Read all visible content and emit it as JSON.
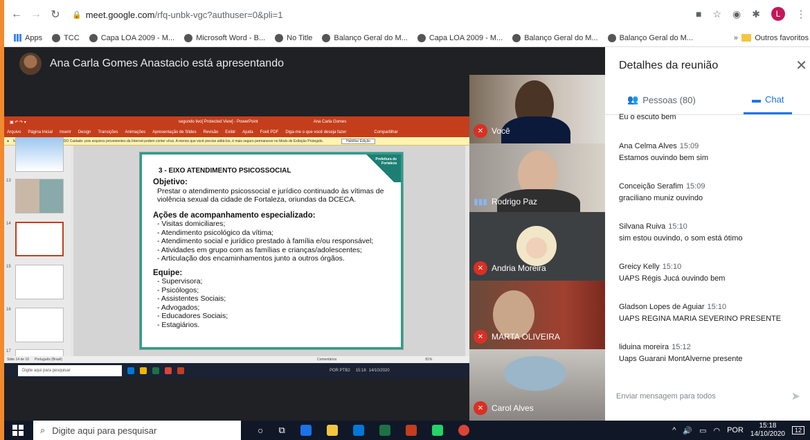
{
  "browser": {
    "url_host": "meet.google.com",
    "url_path": "/rfq-unbk-vgc?authuser=0&pli=1",
    "profile_initial": "L",
    "bookmarks": [
      "Apps",
      "TCC",
      "Capa LOA 2009 - M...",
      "Microsoft Word - B...",
      "No Title",
      "Balanço Geral do M...",
      "Capa LOA 2009 - M...",
      "Balanço Geral do M...",
      "Balanço Geral do M..."
    ],
    "bookmarks_more": "»",
    "other_favorites": "Outros favoritos"
  },
  "presentation": {
    "presenter_text": "Ana Carla Gomes Anastacio está apresentando",
    "ppt": {
      "title_bar": "segundo livo[ Protected View] - PowerPoint",
      "user": "Ana Carla Gomes",
      "menu": [
        "Arquivo",
        "Página Inicial",
        "Inserir",
        "Design",
        "Transições",
        "Animações",
        "Apresentação de Slides",
        "Revisão",
        "Exibir",
        "Ajuda",
        "Foxit PDF",
        "Diga-me o que você deseja fazer",
        "Compartilhar"
      ],
      "warning": "MODO DE EXIBIÇÃO PROTEGIDO   Cuidado: pois arquivos provenientes da Internet podem conter vírus. A menos que você precise editá-los, é mais seguro permanecer no Modo de Exibição Protegido.",
      "enable_button": "Habilitar Edição",
      "thumb_numbers": [
        "13",
        "14",
        "15",
        "16",
        "17"
      ],
      "status_left": "Slide 14 de 16",
      "status_lang": "Português (Brasil)",
      "status_comments": "Comentários",
      "status_zoom": "81%",
      "inner_search": "Digite aqui para pesquisar",
      "inner_lang": "POR PTB2",
      "inner_time": "15:18",
      "inner_date": "14/10/2020"
    },
    "slide": {
      "logo": "Prefeitura de Fortaleza",
      "title": "3 - EIXO ATENDIMENTO PSICOSSOCIAL",
      "objective_heading": "Objetivo:",
      "objective_text": "Prestar o atendimento psicossocial e jurídico continuado às vítimas de violência sexual da cidade de Fortaleza, oriundas da DCECA.",
      "actions_heading": "Ações de acompanhamento especializado:",
      "actions": [
        "- Visitas domiciliares;",
        "- Atendimento psicológico da vítima;",
        "- Atendimento social e jurídico prestado à família e/ou responsável;",
        "- Atividades em grupo com as famílias e crianças/adolescentes;",
        "- Articulação dos encaminhamentos junto a outros órgãos."
      ],
      "team_heading": "Equipe:",
      "team": [
        "- Supervisora;",
        "- Psicólogos;",
        "- Assistentes Sociais;",
        "- Advogados;",
        "- Educadores Sociais;",
        "- Estagiários."
      ]
    }
  },
  "participants": [
    {
      "name": "Você",
      "muted": true
    },
    {
      "name": "Rodrigo Paz",
      "muted": false
    },
    {
      "name": "Andria Moreira",
      "muted": true
    },
    {
      "name": "MARTA OLIVEIRA",
      "muted": true
    },
    {
      "name": "Carol Alves",
      "muted": true
    }
  ],
  "panel": {
    "title": "Detalhes da reunião",
    "tab_people": "Pessoas (80)",
    "tab_chat": "Chat",
    "messages": [
      {
        "sender": "",
        "time": "",
        "text": "Eu o escuto bem"
      },
      {
        "sender": "Ana Celma Alves",
        "time": "15:09",
        "text": "Estamos ouvindo bem sim"
      },
      {
        "sender": "Conceição Serafim",
        "time": "15:09",
        "text": "graciliano muniz ouvindo"
      },
      {
        "sender": "Silvana Ruiva",
        "time": "15:10",
        "text": "sim estou ouvindo,  o som  está ótimo"
      },
      {
        "sender": "Greicy Kelly",
        "time": "15:10",
        "text": "UAPS Régis Jucá ouvindo bem"
      },
      {
        "sender": "Gladson Lopes de Aguiar",
        "time": "15:10",
        "text": "UAPS REGINA MARIA SEVERINO PRESENTE"
      },
      {
        "sender": "liduina moreira",
        "time": "15:12",
        "text": "Uaps Guarani MontAlverne presente"
      }
    ],
    "compose_placeholder": "Enviar mensagem para todos"
  },
  "taskbar": {
    "search": "Digite aqui para pesquisar",
    "lang": "POR",
    "time": "15:18",
    "date": "14/10/2020",
    "notifications": "12"
  }
}
